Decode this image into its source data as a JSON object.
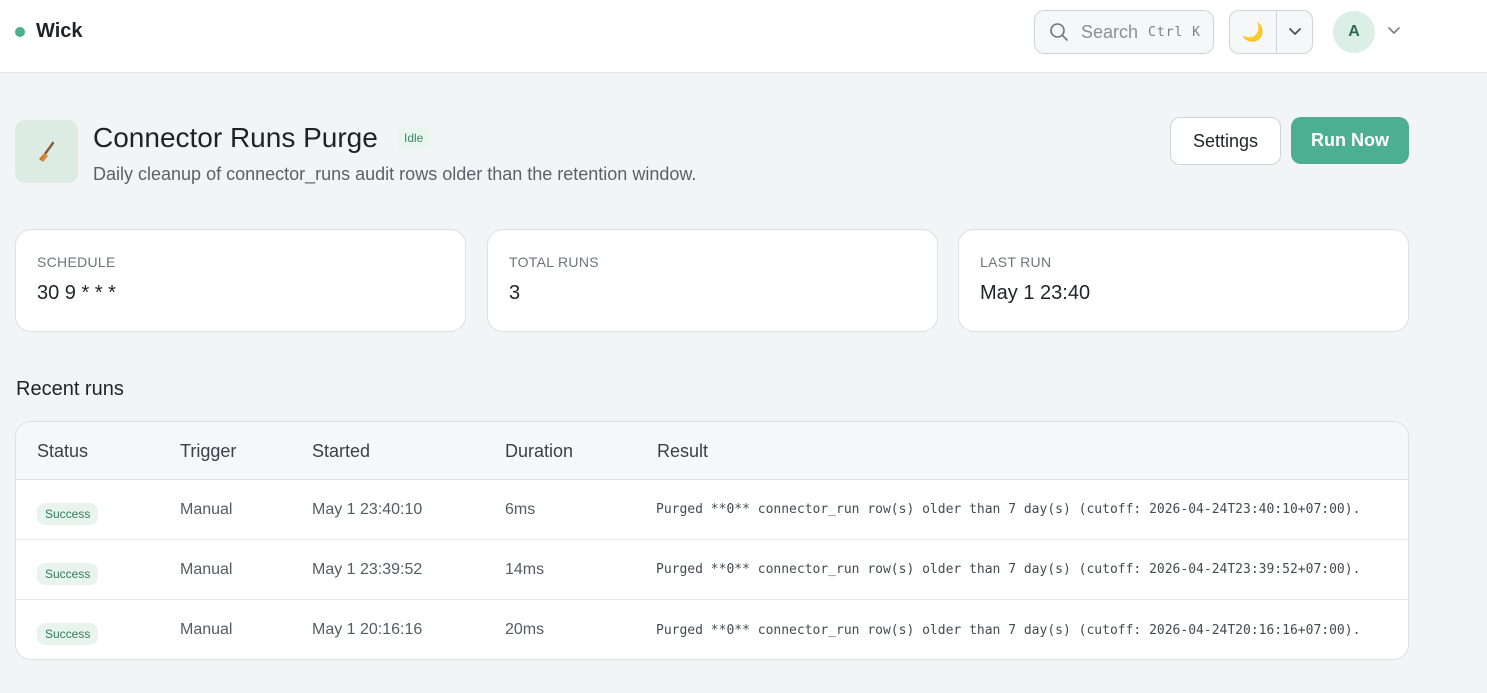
{
  "app": {
    "name": "Wick",
    "status_color": "#4caf8f"
  },
  "search": {
    "placeholder": "Search",
    "shortcut": "Ctrl K",
    "icon": "search-icon"
  },
  "theme": {
    "icon": "moon-icon",
    "menu_icon": "chevron-down-icon"
  },
  "user": {
    "initial": "A"
  },
  "job": {
    "icon": "broom-icon",
    "title": "Connector Runs Purge",
    "status": "Idle",
    "description": "Daily cleanup of connector_runs audit rows older than the retention window.",
    "settings_label": "Settings",
    "run_label": "Run Now"
  },
  "stats": [
    {
      "label": "SCHEDULE",
      "value": "30 9 * * *"
    },
    {
      "label": "TOTAL RUNS",
      "value": "3"
    },
    {
      "label": "LAST RUN",
      "value": "May 1 23:40"
    }
  ],
  "runs": {
    "title": "Recent runs",
    "columns": [
      "Status",
      "Trigger",
      "Started",
      "Duration",
      "Result"
    ],
    "rows": [
      {
        "status": "Success",
        "trigger": "Manual",
        "started": "May 1 23:40:10",
        "duration": "6ms",
        "result": "Purged **0** connector_run row(s) older than 7 day(s) (cutoff: 2026-04-24T23:40:10+07:00)."
      },
      {
        "status": "Success",
        "trigger": "Manual",
        "started": "May 1 23:39:52",
        "duration": "14ms",
        "result": "Purged **0** connector_run row(s) older than 7 day(s) (cutoff: 2026-04-24T23:39:52+07:00)."
      },
      {
        "status": "Success",
        "trigger": "Manual",
        "started": "May 1 20:16:16",
        "duration": "20ms",
        "result": "Purged **0** connector_run row(s) older than 7 day(s) (cutoff: 2026-04-24T20:16:16+07:00)."
      }
    ]
  },
  "colors": {
    "accent": "#4caf8f",
    "success_bg": "#e8f4ed",
    "success_text": "#2f7d55"
  }
}
